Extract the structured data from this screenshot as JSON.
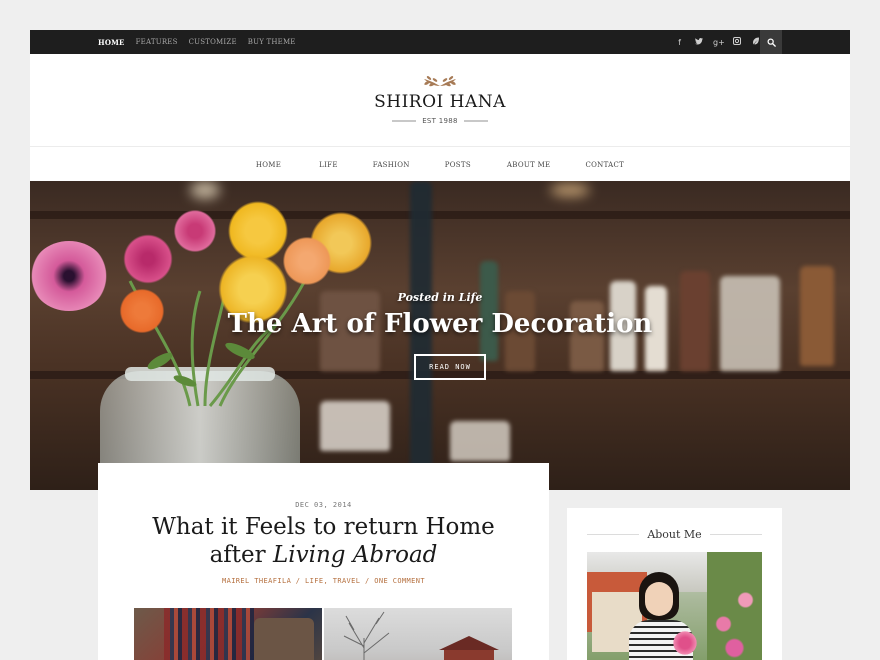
{
  "topbar": {
    "nav": [
      "HOME",
      "FEATURES",
      "CUSTOMIZE",
      "BUY THEME"
    ],
    "social_icons": [
      "facebook-icon",
      "twitter-icon",
      "google-plus-icon",
      "instagram-icon",
      "leaf-icon"
    ],
    "social_glyphs": [
      "f",
      "t",
      "g+",
      "◘",
      "❧"
    ],
    "search_icon": "search-icon"
  },
  "header": {
    "site_title": "SHIROI HANA",
    "established": "EST 1988"
  },
  "mainnav": [
    "HOME",
    "LIFE",
    "FASHION",
    "POSTS",
    "ABOUT ME",
    "CONTACT"
  ],
  "hero": {
    "category": "Posted in Life",
    "title": "The Art of Flower Decoration",
    "button": "READ NOW"
  },
  "post": {
    "date": "DEC 03, 2014",
    "title_line1": "What it Feels to return Home",
    "title_line2_prefix": "after ",
    "title_line2_em": "Living Abroad",
    "meta": "MAIREL THEAFILA / LIFE, TRAVEL / ONE COMMENT"
  },
  "sidebar": {
    "widget_title": "About Me"
  },
  "colors": {
    "topbar_bg": "#1e1e1e",
    "accent_meta": "#b5703f",
    "leaf_accent": "#a77b56"
  }
}
